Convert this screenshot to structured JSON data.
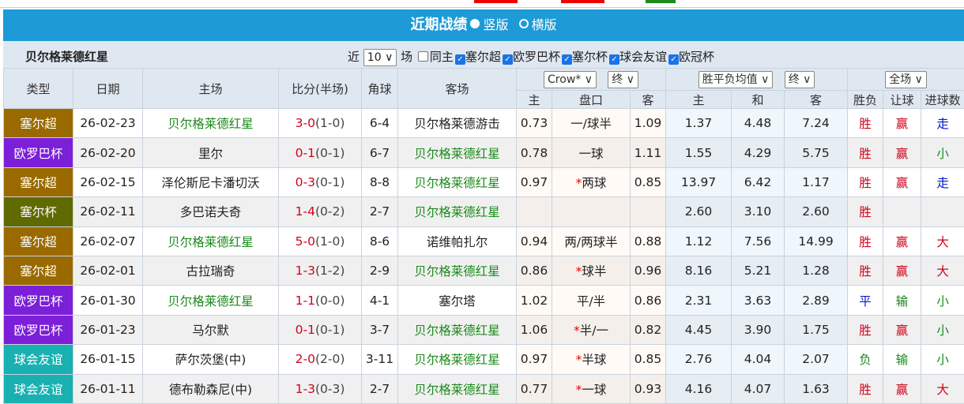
{
  "header": {
    "title": "近期战绩",
    "option_vertical": "竖版",
    "option_horizontal": "横版"
  },
  "filter": {
    "team": "贝尔格莱德红星",
    "prefix": "近",
    "count": "10",
    "suffix": "场",
    "same_home": "同主",
    "leagues": [
      {
        "label": "塞尔超",
        "checked": true
      },
      {
        "label": "欧罗巴杯",
        "checked": true
      },
      {
        "label": "塞尔杯",
        "checked": true
      },
      {
        "label": "球会友谊",
        "checked": true
      },
      {
        "label": "欧冠杯",
        "checked": true
      }
    ]
  },
  "columns": {
    "type": "类型",
    "date": "日期",
    "home": "主场",
    "score": "比分(半场)",
    "corner": "角球",
    "away": "客场",
    "company": "Crow*",
    "odds_time": "终",
    "ox_type": "胜平负均值",
    "ox_time": "终",
    "scope": "全场",
    "sub": {
      "h_home": "主",
      "h_line": "盘口",
      "h_away": "客",
      "o_home": "主",
      "o_draw": "和",
      "o_away": "客",
      "r_wl": "胜负",
      "r_hc": "让球",
      "r_goals": "进球数"
    }
  },
  "colors": {
    "塞尔超": "#9a6a00",
    "欧罗巴杯": "#7b1fd8",
    "塞尔杯": "#5f6a00",
    "球会友谊": "#18b0b0",
    "team_highlight": "#1a8a1a",
    "score": "#d0021b"
  },
  "rows": [
    {
      "type": "塞尔超",
      "date": "26-02-23",
      "home": "贝尔格莱德红星",
      "ft": "3-0",
      "ht": "(1-0)",
      "corner": "6-4",
      "away": "贝尔格莱德游击",
      "hh": "0.73",
      "star": "",
      "line": "一/球半",
      "ha": "1.09",
      "oh": "1.37",
      "od": "4.48",
      "oa": "7.24",
      "wl": "胜",
      "hc": "赢",
      "goals": "走"
    },
    {
      "type": "欧罗巴杯",
      "date": "26-02-20",
      "home": "里尔",
      "ft": "0-1",
      "ht": "(0-1)",
      "corner": "6-7",
      "away": "贝尔格莱德红星",
      "hh": "0.78",
      "star": "",
      "line": "一球",
      "ha": "1.11",
      "oh": "1.55",
      "od": "4.29",
      "oa": "5.75",
      "wl": "胜",
      "hc": "赢",
      "goals": "小"
    },
    {
      "type": "塞尔超",
      "date": "26-02-15",
      "home": "泽伦斯尼卡潘切沃",
      "ft": "0-3",
      "ht": "(0-1)",
      "corner": "8-8",
      "away": "贝尔格莱德红星",
      "hh": "0.97",
      "star": "*",
      "line": "两球",
      "ha": "0.85",
      "oh": "13.97",
      "od": "6.42",
      "oa": "1.17",
      "wl": "胜",
      "hc": "赢",
      "goals": "走"
    },
    {
      "type": "塞尔杯",
      "date": "26-02-11",
      "home": "多巴诺夫奇",
      "ft": "1-4",
      "ht": "(0-2)",
      "corner": "2-7",
      "away": "贝尔格莱德红星",
      "hh": "",
      "star": "",
      "line": "",
      "ha": "",
      "oh": "2.60",
      "od": "3.10",
      "oa": "2.60",
      "wl": "胜",
      "hc": "",
      "goals": ""
    },
    {
      "type": "塞尔超",
      "date": "26-02-07",
      "home": "贝尔格莱德红星",
      "ft": "5-0",
      "ht": "(1-0)",
      "corner": "8-6",
      "away": "诺维帕扎尔",
      "hh": "0.94",
      "star": "",
      "line": "两/两球半",
      "ha": "0.88",
      "oh": "1.12",
      "od": "7.56",
      "oa": "14.99",
      "wl": "胜",
      "hc": "赢",
      "goals": "大"
    },
    {
      "type": "塞尔超",
      "date": "26-02-01",
      "home": "古拉瑞奇",
      "ft": "1-3",
      "ht": "(1-2)",
      "corner": "2-9",
      "away": "贝尔格莱德红星",
      "hh": "0.86",
      "star": "*",
      "line": "球半",
      "ha": "0.96",
      "oh": "8.16",
      "od": "5.21",
      "oa": "1.28",
      "wl": "胜",
      "hc": "赢",
      "goals": "大"
    },
    {
      "type": "欧罗巴杯",
      "date": "26-01-30",
      "home": "贝尔格莱德红星",
      "ft": "1-1",
      "ht": "(0-0)",
      "corner": "4-1",
      "away": "塞尔塔",
      "hh": "1.02",
      "star": "",
      "line": "平/半",
      "ha": "0.86",
      "oh": "2.31",
      "od": "3.63",
      "oa": "2.89",
      "wl": "平",
      "hc": "输",
      "goals": "小"
    },
    {
      "type": "欧罗巴杯",
      "date": "26-01-23",
      "home": "马尔默",
      "ft": "0-1",
      "ht": "(0-1)",
      "corner": "3-7",
      "away": "贝尔格莱德红星",
      "hh": "1.06",
      "star": "*",
      "line": "半/一",
      "ha": "0.82",
      "oh": "4.45",
      "od": "3.90",
      "oa": "1.75",
      "wl": "胜",
      "hc": "赢",
      "goals": "小"
    },
    {
      "type": "球会友谊",
      "date": "26-01-15",
      "home": "萨尔茨堡(中)",
      "ft": "2-0",
      "ht": "(2-0)",
      "corner": "3-11",
      "away": "贝尔格莱德红星",
      "hh": "0.97",
      "star": "*",
      "line": "半球",
      "ha": "0.85",
      "oh": "2.76",
      "od": "4.04",
      "oa": "2.07",
      "wl": "负",
      "hc": "输",
      "goals": "小"
    },
    {
      "type": "球会友谊",
      "date": "26-01-11",
      "home": "德布勒森尼(中)",
      "ft": "1-3",
      "ht": "(0-3)",
      "corner": "2-7",
      "away": "贝尔格莱德红星",
      "hh": "0.77",
      "star": "*",
      "line": "一球",
      "ha": "0.93",
      "oh": "4.16",
      "od": "4.07",
      "oa": "1.63",
      "wl": "胜",
      "hc": "赢",
      "goals": "大"
    }
  ]
}
